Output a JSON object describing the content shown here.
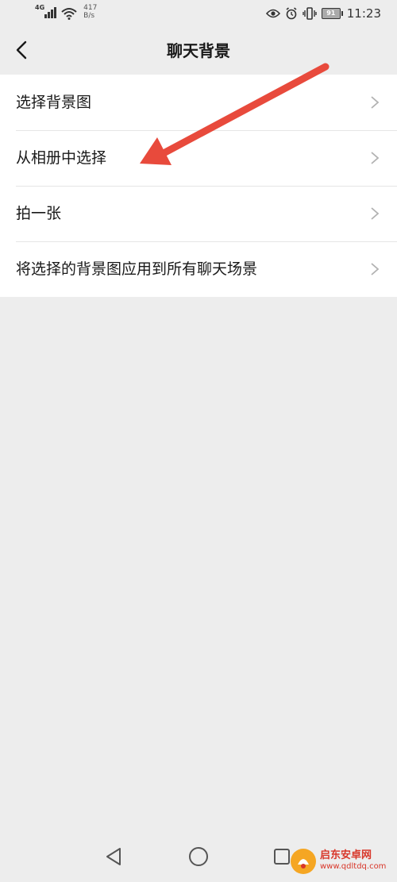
{
  "status_bar": {
    "network": "4G",
    "speed_value": "417",
    "speed_unit": "B/s",
    "battery": "91",
    "time": "11:23",
    "icons": [
      "signal-icon",
      "wifi-icon",
      "eye-icon",
      "alarm-icon",
      "vibrate-icon",
      "battery-icon"
    ]
  },
  "navbar": {
    "title": "聊天背景",
    "back_icon": "chevron-left-icon"
  },
  "menu": {
    "items": [
      {
        "label": "选择背景图"
      },
      {
        "label": "从相册中选择"
      },
      {
        "label": "拍一张"
      },
      {
        "label": "将选择的背景图应用到所有聊天场景"
      }
    ]
  },
  "annotation": {
    "color": "#e84a3c",
    "points_to": "从相册中选择"
  },
  "system_nav": {
    "icons": [
      "back-triangle-icon",
      "home-circle-icon",
      "recents-square-icon"
    ]
  },
  "watermark": {
    "brand": "启东安卓网",
    "url": "www.qdltdq.com"
  },
  "colors": {
    "background": "#ededed",
    "list_background": "#ffffff",
    "text": "#191919",
    "chevron": "#b2b2b2"
  }
}
